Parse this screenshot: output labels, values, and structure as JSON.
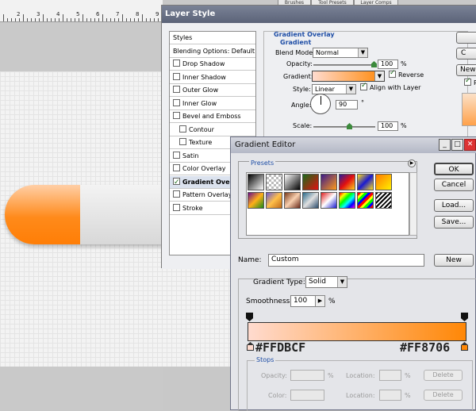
{
  "canvas": {
    "ruler_numbers": [
      "2",
      "3",
      "4",
      "5",
      "6",
      "7",
      "8",
      "9"
    ],
    "top_tabs": [
      "Brushes",
      "Tool Presets",
      "Layer Comps"
    ]
  },
  "layer_style": {
    "title": "Layer Style",
    "list": [
      {
        "label": "Styles",
        "checkbox": false,
        "checked": false,
        "indent": false,
        "selected": false
      },
      {
        "label": "Blending Options: Default",
        "checkbox": false,
        "checked": false,
        "indent": false,
        "selected": false
      },
      {
        "label": "Drop Shadow",
        "checkbox": true,
        "checked": false,
        "indent": false,
        "selected": false
      },
      {
        "label": "Inner Shadow",
        "checkbox": true,
        "checked": false,
        "indent": false,
        "selected": false
      },
      {
        "label": "Outer Glow",
        "checkbox": true,
        "checked": false,
        "indent": false,
        "selected": false
      },
      {
        "label": "Inner Glow",
        "checkbox": true,
        "checked": false,
        "indent": false,
        "selected": false
      },
      {
        "label": "Bevel and Emboss",
        "checkbox": true,
        "checked": false,
        "indent": false,
        "selected": false
      },
      {
        "label": "Contour",
        "checkbox": true,
        "checked": false,
        "indent": true,
        "selected": false
      },
      {
        "label": "Texture",
        "checkbox": true,
        "checked": false,
        "indent": true,
        "selected": false
      },
      {
        "label": "Satin",
        "checkbox": true,
        "checked": false,
        "indent": false,
        "selected": false
      },
      {
        "label": "Color Overlay",
        "checkbox": true,
        "checked": false,
        "indent": false,
        "selected": false
      },
      {
        "label": "Gradient Overlay",
        "checkbox": true,
        "checked": true,
        "indent": false,
        "selected": true
      },
      {
        "label": "Pattern Overlay",
        "checkbox": true,
        "checked": false,
        "indent": false,
        "selected": false
      },
      {
        "label": "Stroke",
        "checkbox": true,
        "checked": false,
        "indent": false,
        "selected": false
      }
    ],
    "section_title": "Gradient Overlay",
    "subsection_title": "Gradient",
    "blend_mode_label": "Blend Mode:",
    "blend_mode_value": "Normal",
    "opacity_label": "Opacity:",
    "opacity_value": "100",
    "opacity_unit": "%",
    "gradient_label": "Gradient:",
    "reverse_label": "Reverse",
    "reverse_checked": true,
    "style_label": "Style:",
    "style_value": "Linear",
    "align_label": "Align with Layer",
    "align_checked": true,
    "angle_label": "Angle:",
    "angle_value": "90",
    "angle_unit": "°",
    "scale_label": "Scale:",
    "scale_value": "100",
    "scale_unit": "%",
    "right_buttons": [
      "",
      "C",
      "New"
    ],
    "preview_label": "P"
  },
  "gradient_editor": {
    "title": "Gradient Editor",
    "presets_label": "Presets",
    "ok_label": "OK",
    "cancel_label": "Cancel",
    "load_label": "Load...",
    "save_label": "Save...",
    "name_label": "Name:",
    "name_value": "Custom",
    "new_label": "New",
    "gradient_type_label": "Gradient Type:",
    "gradient_type_value": "Solid",
    "smoothness_label": "Smoothness:",
    "smoothness_value": "100",
    "smoothness_unit": "%",
    "start_color": "#FFDBCF",
    "end_color": "#FF8706",
    "stops": {
      "title": "Stops",
      "opacity_label": "Opacity:",
      "opacity_unit": "%",
      "location_label": "Location:",
      "location_unit": "%",
      "color_label": "Color:",
      "delete_label": "Delete"
    }
  }
}
